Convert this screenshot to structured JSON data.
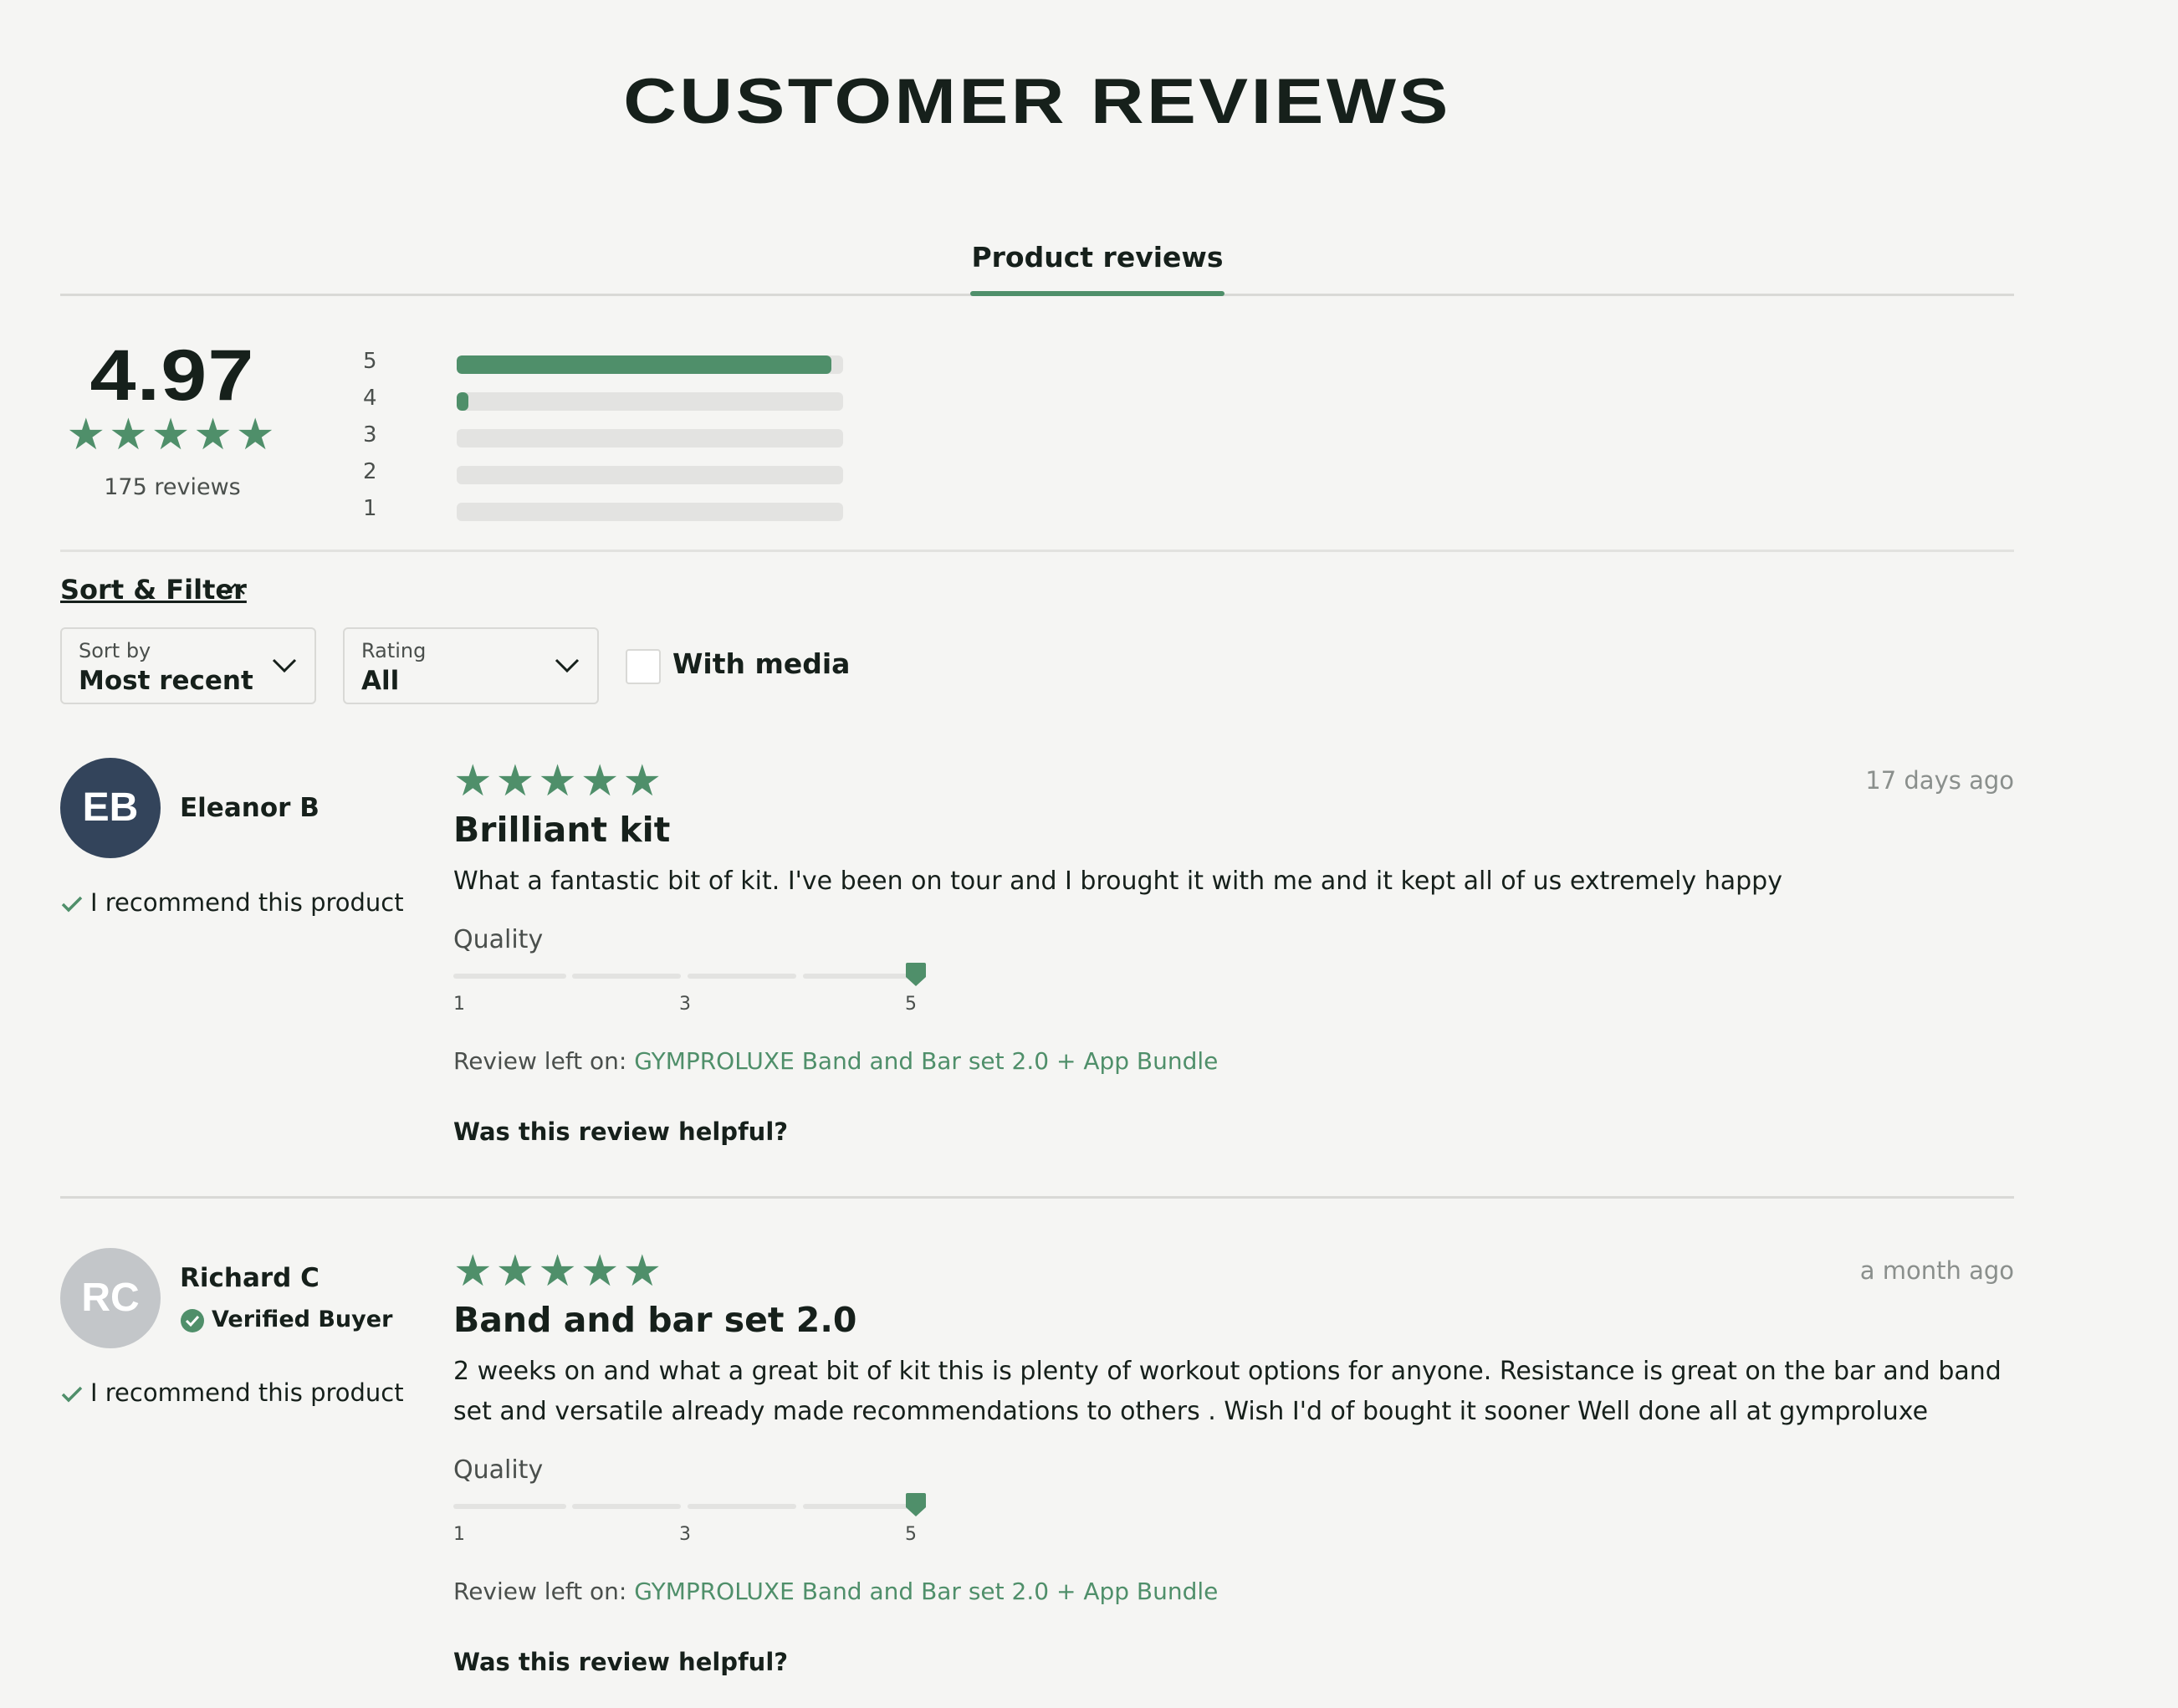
{
  "page_title": "CUSTOMER REVIEWS",
  "tabs": [
    {
      "label": "Product reviews",
      "active": true
    }
  ],
  "summary": {
    "average": "4.97",
    "stars": "★★★★★",
    "count_label": "175 reviews",
    "breakdown": [
      {
        "label": "5",
        "fraction": 0.97
      },
      {
        "label": "4",
        "fraction": 0.03
      },
      {
        "label": "3",
        "fraction": 0
      },
      {
        "label": "2",
        "fraction": 0
      },
      {
        "label": "1",
        "fraction": 0
      }
    ]
  },
  "filters": {
    "toggle_label": "Sort & Filter",
    "sort": {
      "label": "Sort by",
      "value": "Most recent"
    },
    "rating": {
      "label": "Rating",
      "value": "All"
    },
    "media_label": "With media"
  },
  "colors": {
    "accent": "#4f8f6a",
    "avatar_dark": "#33445b",
    "avatar_light": "#c3c6c9",
    "bg": "#f5f5f3"
  },
  "reviews": [
    {
      "initials": "EB",
      "name": "Eleanor B",
      "verified": false,
      "recommend": "I recommend this product",
      "stars": "★★★★★",
      "date": "17 days ago",
      "title": "Brilliant kit",
      "body": "What a fantastic bit of kit. I've been on tour and I brought it with me and it kept all of us extremely happy",
      "quality_label": "Quality",
      "quality_value": 5,
      "quality_ticks": [
        "1",
        "3",
        "5"
      ],
      "left_on_prefix": "Review left on:",
      "left_on_product": "GYMPROLUXE Band and Bar set 2.0 + App Bundle",
      "helpful": "Was this review helpful?"
    },
    {
      "initials": "RC",
      "name": "Richard C",
      "verified": true,
      "verified_label": "Verified Buyer",
      "recommend": "I recommend this product",
      "stars": "★★★★★",
      "date": "a month ago",
      "title": "Band and bar set 2.0",
      "body": "2 weeks on and what a great bit of kit this is plenty of workout options for anyone. Resistance is great on the bar and band set and versatile already made recommendations to others . Wish I'd of bought it sooner Well done all at gymproluxe",
      "quality_label": "Quality",
      "quality_value": 5,
      "quality_ticks": [
        "1",
        "3",
        "5"
      ],
      "left_on_prefix": "Review left on:",
      "left_on_product": "GYMPROLUXE Band and Bar set 2.0 + App Bundle",
      "helpful": "Was this review helpful?"
    }
  ]
}
